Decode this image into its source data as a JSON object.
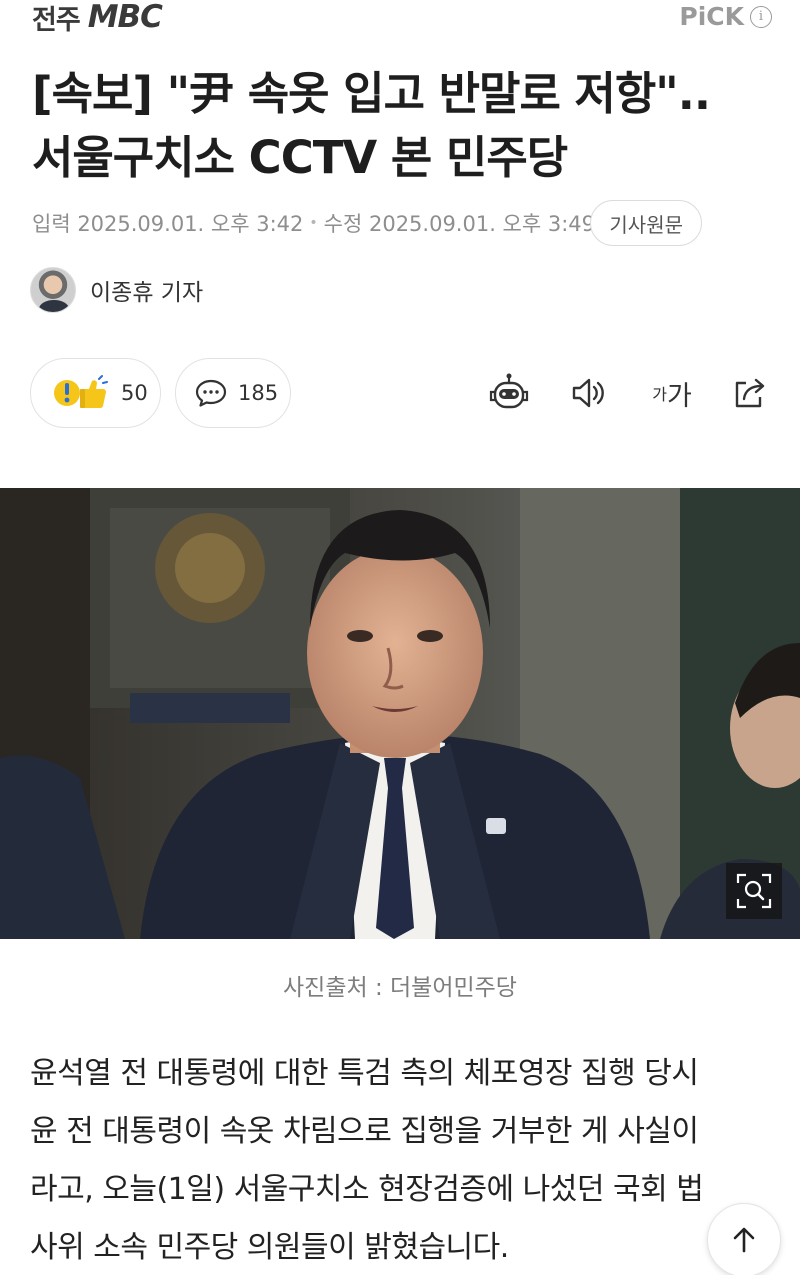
{
  "header": {
    "brand_ko": "전주",
    "brand_mbc": "MBC",
    "pick_label": "PiCK",
    "info_icon": "info-icon"
  },
  "article": {
    "headline_line1": "[속보] \"尹 속옷 입고 반말로 저항\"..",
    "headline_line2": "서울구치소 CCTV 본 민주당",
    "published": "입력 2025.09.01. 오후 3:42",
    "modified": "수정 2025.09.01. 오후 3:49",
    "original_button": "기사원문",
    "author": "이종휴 기자"
  },
  "actions": {
    "reaction_count": "50",
    "comment_count": "185",
    "fontsize_small": "가",
    "fontsize_large": "가",
    "icons": [
      "reaction-icon",
      "comment-icon",
      "summary-bot-icon",
      "speaker-icon",
      "font-size-icon",
      "share-icon"
    ]
  },
  "photo": {
    "caption": "사진출처 : 더불어민주당",
    "zoom_icon": "zoom-icon"
  },
  "body": {
    "lines": [
      "윤석열 전 대통령에 대한 특검 측의 체포영장 집행 당시",
      "윤 전 대통령이 속옷 차림으로 집행을 거부한 게 사실이",
      "라고, 오늘(1일) 서울구치소 현장검증에 나섰던 국회 법",
      "사위 소속 민주당 의원들이 밝혔습니다."
    ]
  },
  "colors": {
    "text_primary": "#1e1e1e",
    "text_meta": "#8e8e8e",
    "border": "#e2e2e2",
    "reaction_yellow": "#f5c51a"
  }
}
